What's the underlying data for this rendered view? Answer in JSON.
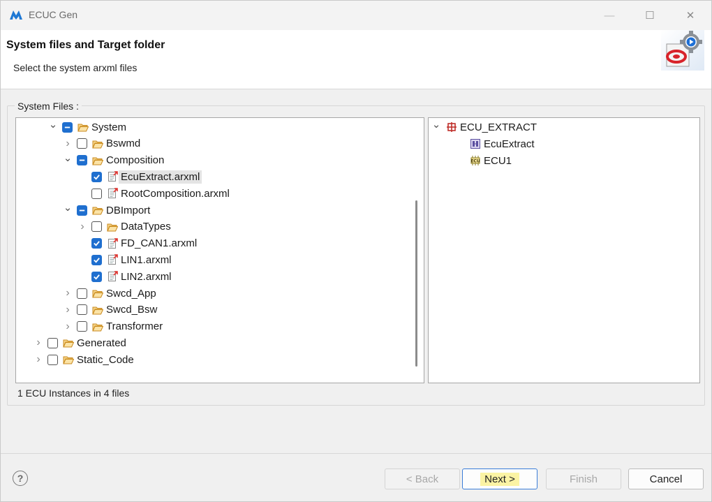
{
  "window": {
    "title": "ECUC Gen",
    "min_symbol": "—",
    "max_symbol": "☐",
    "close_symbol": "✕"
  },
  "header": {
    "title": "System files and Target folder",
    "subtitle": "Select the system arxml files",
    "icon": "wizard-gear-icon"
  },
  "group": {
    "label": "System Files :"
  },
  "left_tree": [
    {
      "label": "System",
      "level": 2,
      "expander": "open",
      "check": "partial",
      "icon": "folder-open-icon"
    },
    {
      "label": "Bswmd",
      "level": 3,
      "expander": "closed",
      "check": "none",
      "icon": "folder-open-icon"
    },
    {
      "label": "Composition",
      "level": 3,
      "expander": "open",
      "check": "partial",
      "icon": "folder-open-icon"
    },
    {
      "label": "EcuExtract.arxml",
      "level": 4,
      "expander": "",
      "check": "checked",
      "icon": "arxml-file-icon",
      "selected": true
    },
    {
      "label": "RootComposition.arxml",
      "level": 4,
      "expander": "",
      "check": "none",
      "icon": "arxml-file-icon"
    },
    {
      "label": "DBImport",
      "level": 3,
      "expander": "open",
      "check": "partial",
      "icon": "folder-open-icon"
    },
    {
      "label": "DataTypes",
      "level": 4,
      "expander": "closed",
      "check": "none",
      "icon": "folder-open-icon"
    },
    {
      "label": "FD_CAN1.arxml",
      "level": 4,
      "expander": "",
      "check": "checked",
      "icon": "arxml-file-icon"
    },
    {
      "label": "LIN1.arxml",
      "level": 4,
      "expander": "",
      "check": "checked",
      "icon": "arxml-file-icon"
    },
    {
      "label": "LIN2.arxml",
      "level": 4,
      "expander": "",
      "check": "checked",
      "icon": "arxml-file-icon"
    },
    {
      "label": "Swcd_App",
      "level": 3,
      "expander": "closed",
      "check": "none",
      "icon": "folder-open-icon"
    },
    {
      "label": "Swcd_Bsw",
      "level": 3,
      "expander": "closed",
      "check": "none",
      "icon": "folder-open-icon"
    },
    {
      "label": "Transformer",
      "level": 3,
      "expander": "closed",
      "check": "none",
      "icon": "folder-open-icon"
    },
    {
      "label": "Generated",
      "level": 1,
      "expander": "closed",
      "check": "none",
      "icon": "folder-open-icon"
    },
    {
      "label": "Static_Code",
      "level": 1,
      "expander": "closed",
      "check": "none",
      "icon": "folder-open-icon"
    }
  ],
  "right_tree": [
    {
      "label": "ECU_EXTRACT",
      "level": 0,
      "expander": "open",
      "icon": "ecu-extract-icon"
    },
    {
      "label": "EcuExtract",
      "level": 1,
      "expander": "",
      "icon": "ecu-extract-item-icon"
    },
    {
      "label": "ECU1",
      "level": 1,
      "expander": "",
      "icon": "ecu-instance-icon"
    }
  ],
  "status": "1 ECU Instances in 4 files",
  "footer": {
    "help_symbol": "?",
    "back_label": "< Back",
    "next_label": "Next >",
    "finish_label": "Finish",
    "cancel_label": "Cancel"
  },
  "colors": {
    "checkbox_blue": "#1f6fcf",
    "folder_orange": "#e8a33a",
    "next_highlight": "#fbf3a4"
  }
}
